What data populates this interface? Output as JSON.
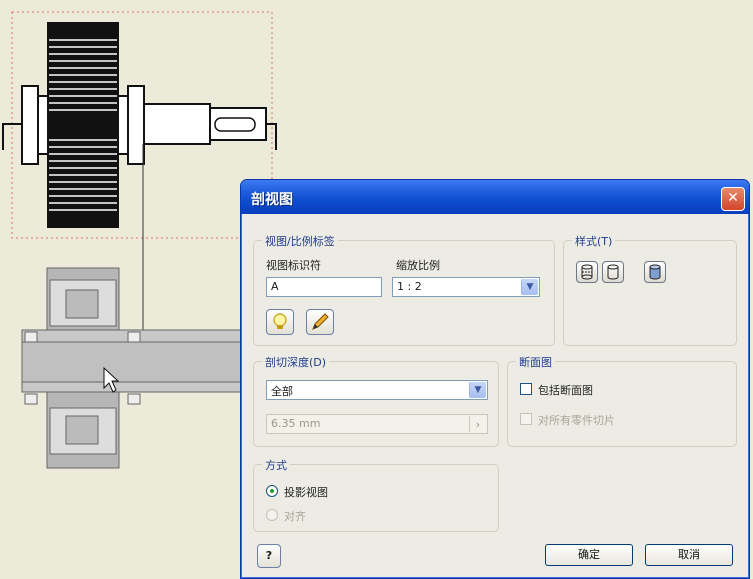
{
  "dialog": {
    "title": "剖视图",
    "close_glyph": "✕"
  },
  "view_scale": {
    "legend": "视图/比例标签",
    "identifier_label": "视图标识符",
    "identifier_value": "A",
    "scale_label": "缩放比例",
    "scale_value": "1 : 2",
    "toggle_label_icon": "lightbulb-icon",
    "edit_label_icon": "pencil-icon"
  },
  "style": {
    "legend": "样式(T)",
    "buttons": [
      "style-hidden-lines-icon",
      "style-hidden-lines-removed-icon",
      "style-shaded-icon"
    ]
  },
  "cut_depth": {
    "legend": "剖切深度(D)",
    "mode_value": "全部",
    "distance_value": "6.35 mm"
  },
  "section": {
    "legend": "断面图",
    "include_slice_label": "包括断面图",
    "slice_all_label": "对所有零件切片"
  },
  "method": {
    "legend": "方式",
    "projected_label": "投影视图",
    "aligned_label": "对齐"
  },
  "buttons": {
    "help_glyph": "?",
    "ok_label": "确定",
    "cancel_label": "取消"
  },
  "colors": {
    "title_bar": "#0a48cc",
    "dialog_bg": "#ecebe4",
    "canvas_bg": "#ecebd9"
  }
}
